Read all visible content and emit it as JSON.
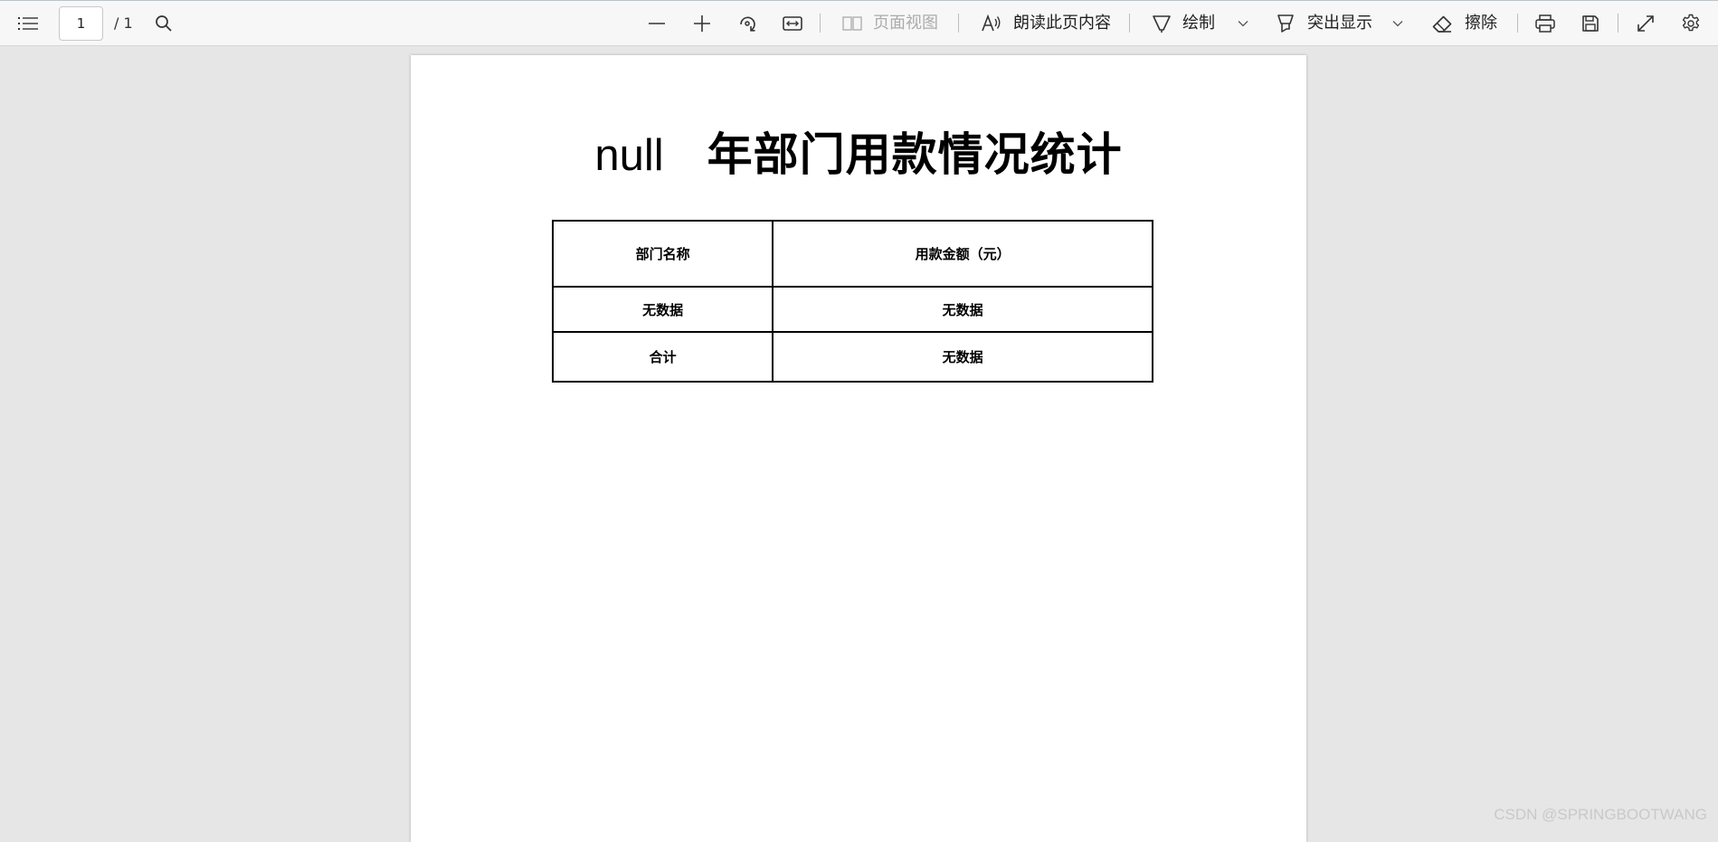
{
  "toolbar": {
    "page_current": "1",
    "page_total": "/ 1",
    "page_view_label": "页面视图",
    "read_aloud_label": "朗读此页内容",
    "draw_label": "绘制",
    "highlight_label": "突出显示",
    "erase_label": "擦除",
    "icons": [
      "contents-icon",
      "search-icon",
      "zoom-out-icon",
      "zoom-in-icon",
      "rotate-icon",
      "fit-width-icon",
      "page-view-icon",
      "read-aloud-icon",
      "draw-icon",
      "chevron-down-icon",
      "highlight-icon",
      "eraser-icon",
      "print-icon",
      "save-icon",
      "fullscreen-icon",
      "settings-icon"
    ]
  },
  "document": {
    "title_prefix": "null",
    "title_main": "年部门用款情况统计",
    "table": {
      "headers": [
        "部门名称",
        "用款金额（元）"
      ],
      "rows": [
        [
          "无数据",
          "无数据"
        ],
        [
          "合计",
          "无数据"
        ]
      ]
    }
  },
  "watermark": "CSDN @SPRINGBOOTWANG"
}
